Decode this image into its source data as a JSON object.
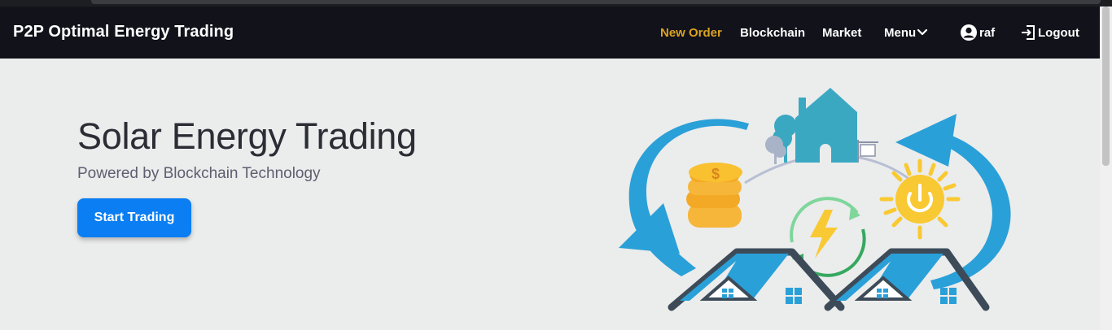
{
  "navbar": {
    "brand": "P2P Optimal Energy Trading",
    "items": [
      {
        "label": "New Order",
        "active": true
      },
      {
        "label": "Blockchain"
      },
      {
        "label": "Market"
      },
      {
        "label": "Menu"
      }
    ],
    "user": "raf",
    "logout": "Logout",
    "active_color": "#dba320"
  },
  "hero": {
    "title": "Solar Energy Trading",
    "subtitle": "Powered by Blockchain Technology",
    "cta_label": "Start Trading"
  },
  "colors": {
    "navbar_bg": "#12121b",
    "page_bg": "#ebecec",
    "accent_blue": "#0a7ef2",
    "arrow_blue": "#2aa0d8",
    "sun_yellow": "#f9c933",
    "coin_orange": "#f6b63a",
    "roof_dark": "#3d4b59",
    "house_teal": "#3ba8c2"
  }
}
